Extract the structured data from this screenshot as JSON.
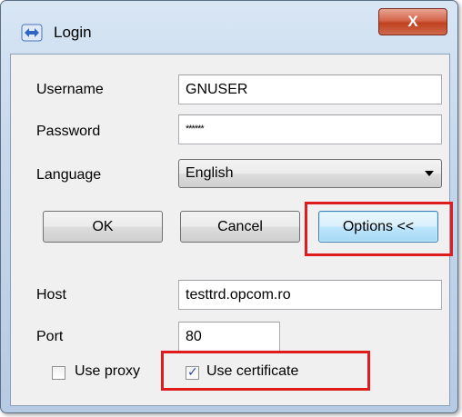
{
  "window": {
    "title": "Login",
    "close_label": "X"
  },
  "form": {
    "username": {
      "label": "Username",
      "value": "GNUSER"
    },
    "password": {
      "label": "Password",
      "value": "******"
    },
    "language": {
      "label": "Language",
      "selected": "English"
    }
  },
  "buttons": {
    "ok": "OK",
    "cancel": "Cancel",
    "options": "Options <<"
  },
  "options": {
    "host": {
      "label": "Host",
      "value": "testtrd.opcom.ro"
    },
    "port": {
      "label": "Port",
      "value": "80"
    },
    "use_proxy": {
      "label": "Use proxy",
      "checked": false
    },
    "use_certificate": {
      "label": "Use certificate",
      "checked": true
    }
  },
  "colors": {
    "highlight": "#e01b1b",
    "titlebar": "#c4d7ec",
    "client": "#f0f0f0"
  },
  "icons": {
    "app": "login-arrows-icon",
    "close": "close-icon",
    "dropdown": "chevron-down-icon",
    "check": "check-icon"
  }
}
